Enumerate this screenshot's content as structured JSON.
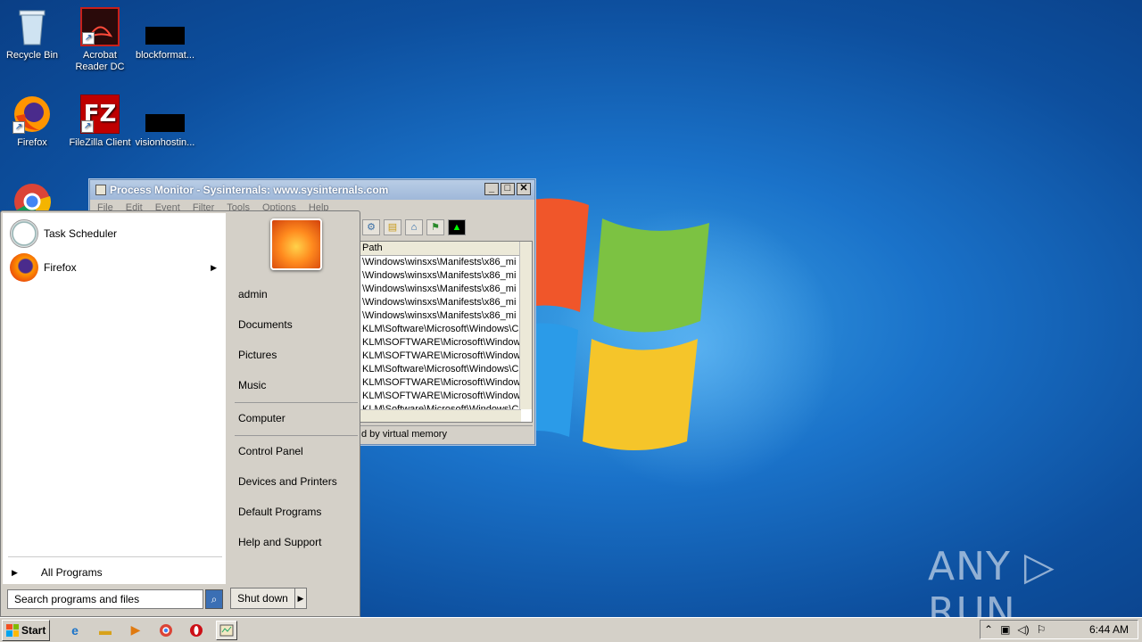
{
  "desktop": {
    "icons": [
      {
        "label": "Recycle Bin",
        "icon": "recycle-bin-icon"
      },
      {
        "label": "Acrobat\nReader DC",
        "icon": "acrobat-icon"
      },
      {
        "label": "blockformat...",
        "icon": "redacted-icon"
      },
      {
        "label": "Firefox",
        "icon": "firefox-icon"
      },
      {
        "label": "FileZilla Client",
        "icon": "filezilla-icon"
      },
      {
        "label": "visionhostin...",
        "icon": "redacted-icon"
      }
    ],
    "watermark": "ANY ▷ RUN"
  },
  "procmon": {
    "title": "Process Monitor - Sysinternals: www.sysinternals.com",
    "menu": [
      "File",
      "Edit",
      "Event",
      "Filter",
      "Tools",
      "Options",
      "Help"
    ],
    "column_header": "Path",
    "rows": [
      "\\Windows\\winsxs\\Manifests\\x86_mi",
      "\\Windows\\winsxs\\Manifests\\x86_mi",
      "\\Windows\\winsxs\\Manifests\\x86_mi",
      "\\Windows\\winsxs\\Manifests\\x86_mi",
      "\\Windows\\winsxs\\Manifests\\x86_mi",
      "KLM\\Software\\Microsoft\\Windows\\C",
      "KLM\\SOFTWARE\\Microsoft\\Window",
      "KLM\\SOFTWARE\\Microsoft\\Window",
      "KLM\\Software\\Microsoft\\Windows\\C",
      "KLM\\SOFTWARE\\Microsoft\\Window",
      "KLM\\SOFTWARE\\Microsoft\\Window",
      "KLM\\Software\\Microsoft\\Windows\\C"
    ],
    "status": "d by virtual memory"
  },
  "start_menu": {
    "programs": [
      {
        "label": "Task Scheduler",
        "icon": "clock-icon"
      },
      {
        "label": "Firefox",
        "icon": "firefox-icon",
        "has_submenu": true
      }
    ],
    "all_programs": "All Programs",
    "search_placeholder": "Search programs and files",
    "right_items": {
      "user": "admin",
      "documents": "Documents",
      "pictures": "Pictures",
      "music": "Music",
      "computer": "Computer",
      "control_panel": "Control Panel",
      "devices": "Devices and Printers",
      "default_programs": "Default Programs",
      "help": "Help and Support"
    },
    "shutdown": "Shut down"
  },
  "taskbar": {
    "start": "Start",
    "clock": "6:44 AM"
  }
}
